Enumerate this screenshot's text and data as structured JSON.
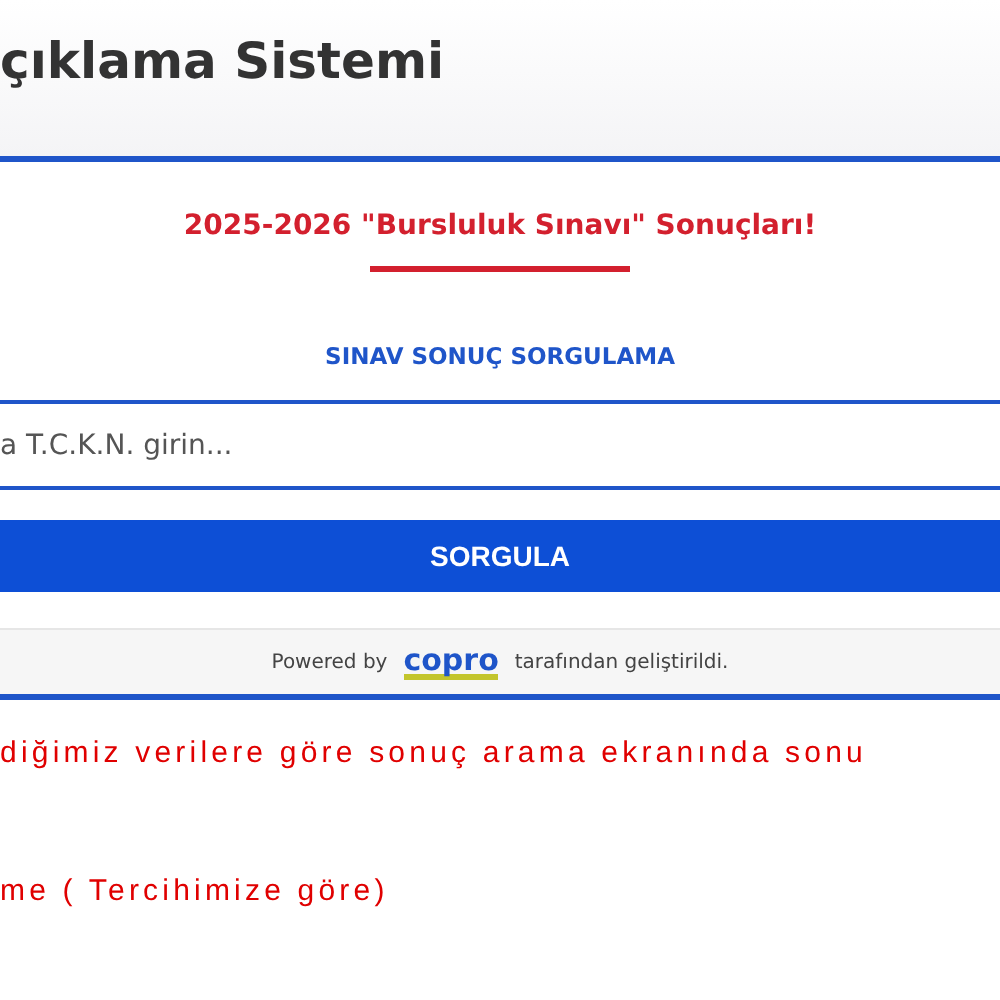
{
  "header": {
    "title": "çıklama Sistemi"
  },
  "card": {
    "heading": "2025-2026 \"Bursluluk Sınavı\" Sonuçları!",
    "subheading": "SINAV SONUÇ SORGULAMA",
    "search": {
      "placeholder": "a T.C.K.N. girin..."
    },
    "button": "SORGULA",
    "footer": {
      "prefix": "Powered by",
      "logo": "copro",
      "suffix": "tarafından geliştirildi."
    }
  },
  "notes": [
    "diğimiz verilere göre sonuç arama ekranında sonu",
    "me ( Tercihimize göre)"
  ]
}
